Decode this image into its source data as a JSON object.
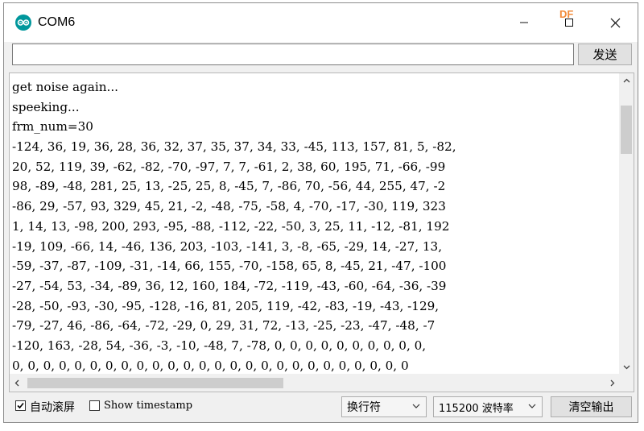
{
  "window": {
    "title": "COM6",
    "badge": "DF"
  },
  "send_row": {
    "input_value": "",
    "send_label": "发送"
  },
  "output": {
    "lines": [
      "get noise again...",
      "speeking...",
      "frm_num=30",
      "-124, 36, 19, 36, 28, 36, 32, 37, 35, 37, 34, 33, -45, 113, 157, 81, 5, -82,",
      "20, 52, 119, 39, -62, -82, -70, -97, 7, 7, -61, 2, 38, 60, 195, 71, -66, -99",
      "98, -89, -48, 281, 25, 13, -25, 25, 8, -45, 7, -86, 70, -56, 44, 255, 47, -2",
      "-86, 29, -57, 93, 329, 45, 21, -2, -48, -75, -58, 4, -70, -17, -30, 119, 323",
      "1, 14, 13, -98, 200, 293, -95, -88, -112, -22, -50, 3, 25, 11, -12, -81, 192",
      "-19, 109, -66, 14, -46, 136, 203, -103, -141, 3, -8, -65, -29, 14, -27, 13,",
      "-59, -37, -87, -109, -31, -14, 66, 155, -70, -158, 65, 8, -45, 21, -47, -100",
      "-27, -54, 53, -34, -89, 36, 12, 160, 184, -72, -119, -43, -60, -64, -36, -39",
      "-28, -50, -93, -30, -95, -128, -16, 81, 205, 119, -42, -83, -19, -43, -129,",
      "-79, -27, 46, -86, -64, -72, -29, 0, 29, 31, 72, -13, -25, -23, -47, -48, -7",
      "-120, 163, -28, 54, -36, -3, -10, -48, 7, -78, 0, 0, 0, 0, 0, 0, 0, 0, 0, 0,",
      "0, 0, 0, 0, 0, 0, 0, 0, 0, 0, 0, 0, 0, 0, 0, 0, 0, 0, 0, 0, 0, 0, 0, 0, 0, 0"
    ]
  },
  "bottom": {
    "autoscroll_label": "自动滚屏",
    "autoscroll_checked": true,
    "timestamp_label": "Show timestamp",
    "timestamp_checked": false,
    "line_ending": "换行符",
    "baud_rate": "115200 波特率",
    "clear_label": "清空输出"
  },
  "colors": {
    "arduino_teal": "#00979c",
    "badge_orange": "#f28b3a"
  }
}
